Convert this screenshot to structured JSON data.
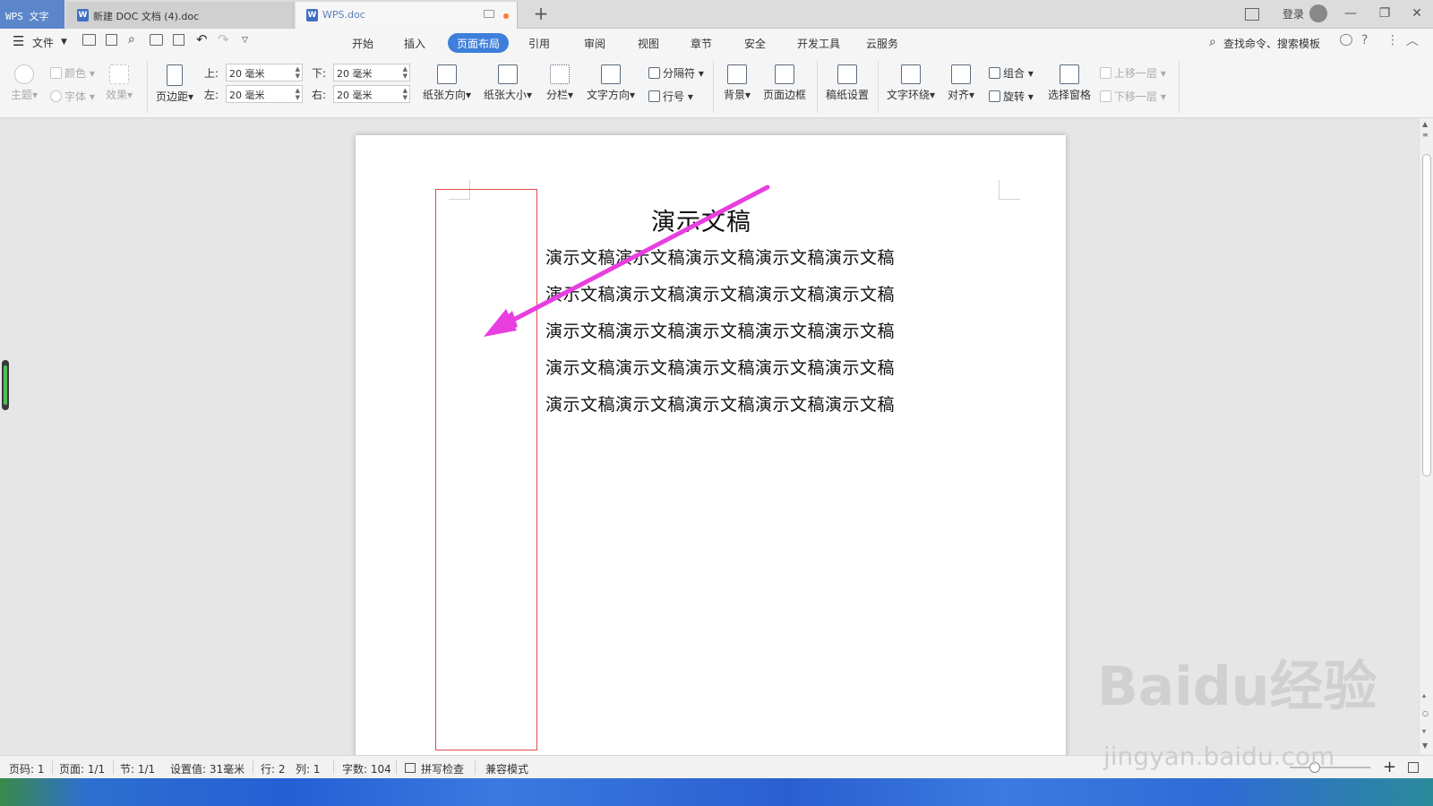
{
  "titlebar": {
    "app_name": "WPS 文字",
    "tabs": [
      {
        "label": "新建 DOC 文档 (4).doc",
        "active": false
      },
      {
        "label": "WPS.doc",
        "active": true
      }
    ],
    "new_tab": "+",
    "login": "登录",
    "minimize": "—",
    "maximize": "❐",
    "close": "✕"
  },
  "menu": {
    "file": "文件",
    "tabs": [
      "开始",
      "插入",
      "页面布局",
      "引用",
      "审阅",
      "视图",
      "章节",
      "安全",
      "开发工具",
      "云服务"
    ],
    "active_tab": "页面布局",
    "search": "查找命令、搜索模板"
  },
  "ribbon": {
    "theme": "主题",
    "color": "颜色",
    "font": "字体",
    "effect": "效果",
    "margins": "页边距",
    "margin_top_label": "上:",
    "margin_top": "20 毫米",
    "margin_bottom_label": "下:",
    "margin_bottom": "20 毫米",
    "margin_left_label": "左:",
    "margin_left": "20 毫米",
    "margin_right_label": "右:",
    "margin_right": "20 毫米",
    "orientation": "纸张方向",
    "size": "纸张大小",
    "columns": "分栏",
    "text_direction": "文字方向",
    "breaks": "分隔符",
    "line_numbers": "行号",
    "background": "背景",
    "page_border": "页面边框",
    "manuscript": "稿纸设置",
    "wrap_text": "文字环绕",
    "align": "对齐",
    "group": "组合",
    "rotate": "旋转",
    "selection_pane": "选择窗格",
    "bring_forward": "上移一层",
    "send_backward": "下移一层"
  },
  "document": {
    "title": "演示文稿",
    "lines": [
      "演示文稿演示文稿演示文稿演示文稿演示文稿",
      "演示文稿演示文稿演示文稿演示文稿演示文稿",
      "演示文稿演示文稿演示文稿演示文稿演示文稿",
      "演示文稿演示文稿演示文稿演示文稿演示文稿",
      "演示文稿演示文稿演示文稿演示文稿演示文稿"
    ]
  },
  "status": {
    "page_no": "页码: 1",
    "pages": "页面: 1/1",
    "section": "节: 1/1",
    "setting": "设置值: 31毫米",
    "row": "行: 2",
    "col": "列: 1",
    "words": "字数: 104",
    "spell_check": "拼写检查",
    "compat": "兼容模式",
    "zoom_in": "+"
  },
  "watermark": {
    "brand": "Baidu经验",
    "url": "jingyan.baidu.com"
  },
  "colors": {
    "accent": "#3e7fdc",
    "annotation_arrow": "#e83ee0",
    "margin_box": "#e04a4a"
  }
}
